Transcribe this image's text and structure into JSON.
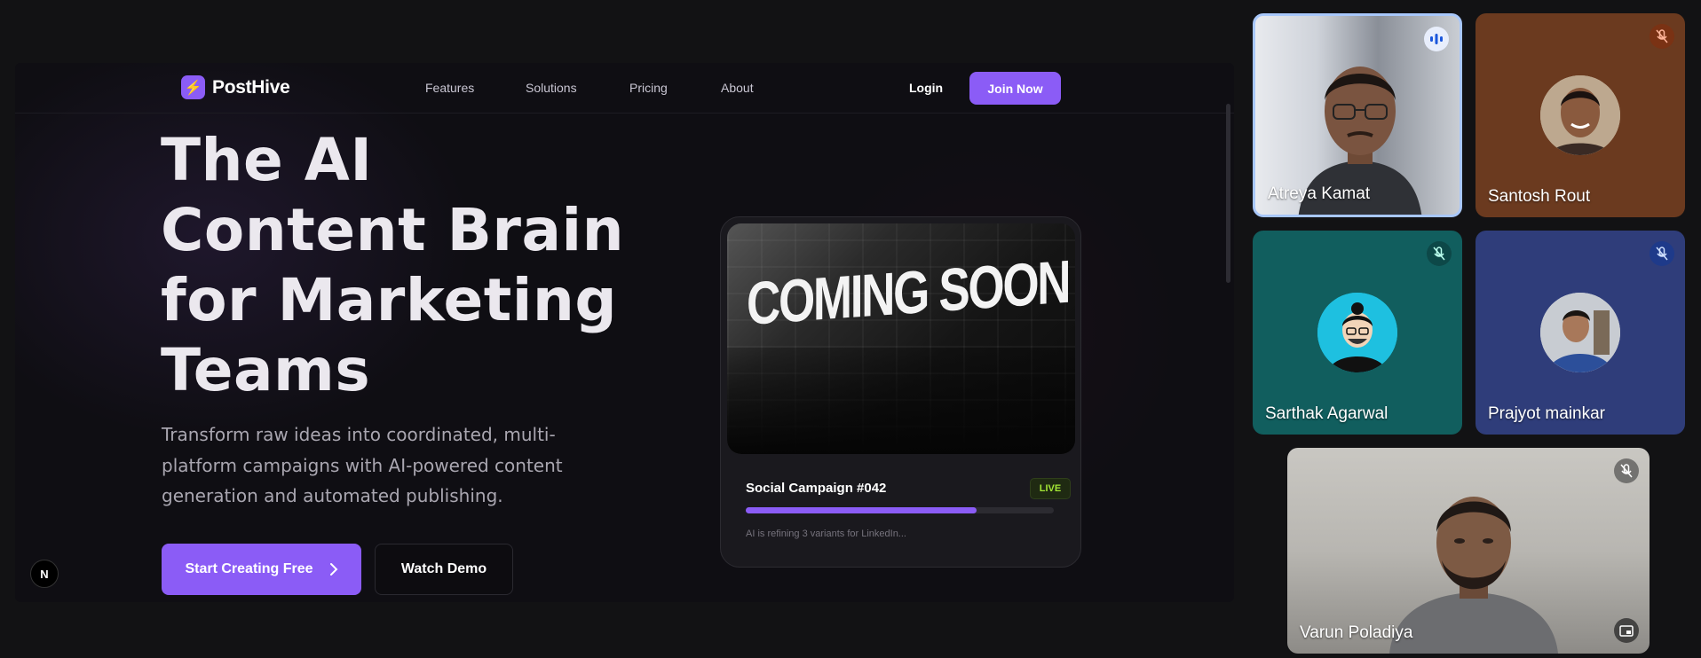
{
  "site": {
    "logo_text": "PostHive",
    "nav": [
      "Features",
      "Solutions",
      "Pricing",
      "About"
    ],
    "login": "Login",
    "join": "Join Now",
    "hero_title": "The AI Content Brain for Marketing Teams",
    "hero_subtitle": "Transform raw ideas into coordinated, multi-platform campaigns with AI-powered content generation and automated publishing.",
    "cta_primary": "Start Creating Free",
    "cta_secondary": "Watch Demo",
    "badge": "N",
    "card": {
      "image_text": "COMING SOON",
      "title": "Social Campaign #042",
      "status": "LIVE",
      "progress": 0.75,
      "note": "AI is refining 3 variants for LinkedIn..."
    }
  },
  "participants": [
    {
      "name": "Atreya Kamat",
      "speaking": true
    },
    {
      "name": "Santosh Rout",
      "muted": true
    },
    {
      "name": "Sarthak Agarwal",
      "muted": true
    },
    {
      "name": "Prajyot mainkar",
      "muted": true
    },
    {
      "name": "Varun Poladiya",
      "muted": true
    }
  ],
  "colors": {
    "accent": "#8b5cf6",
    "live": "#a3e635",
    "tile_santosh": "#6b3a1f",
    "tile_sarthak": "#115e5e",
    "tile_prajyot": "#2f3d7a"
  }
}
